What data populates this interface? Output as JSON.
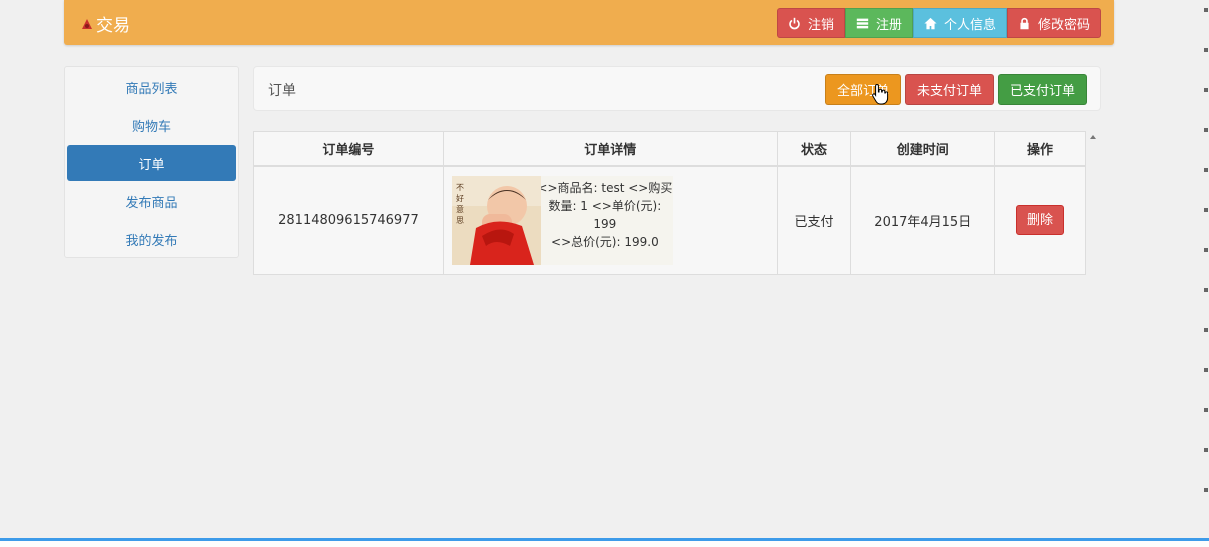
{
  "brand": {
    "title": "交易"
  },
  "nav": {
    "logout": "注销",
    "register": "注册",
    "profile": "个人信息",
    "change_password": "修改密码"
  },
  "sidebar": {
    "items": [
      {
        "label": "商品列表"
      },
      {
        "label": "购物车"
      },
      {
        "label": "订单"
      },
      {
        "label": "发布商品"
      },
      {
        "label": "我的发布"
      }
    ],
    "active_index": 2
  },
  "panel": {
    "title": "订单",
    "filters": {
      "all": "全部订单",
      "unpaid": "未支付订单",
      "paid": "已支付订单"
    }
  },
  "table": {
    "headers": [
      "订单编号",
      "订单详情",
      "状态",
      "创建时间",
      "操作"
    ],
    "rows": [
      {
        "order_no": "28114809615746977",
        "detail_line1": "<>商品名: test <>购买",
        "detail_line2": "数量: 1 <>单价(元): 199",
        "detail_line3": "<>总价(元): 199.0",
        "image_text": "不好意思",
        "status": "已支付",
        "created": "2017年4月15日",
        "action": "删除"
      }
    ]
  },
  "colors": {
    "navbar": "#f0ad4e",
    "primary": "#337ab7",
    "danger": "#d9534f",
    "success": "#5cb85c",
    "info": "#5bc0de",
    "warning": "#ec971f"
  }
}
